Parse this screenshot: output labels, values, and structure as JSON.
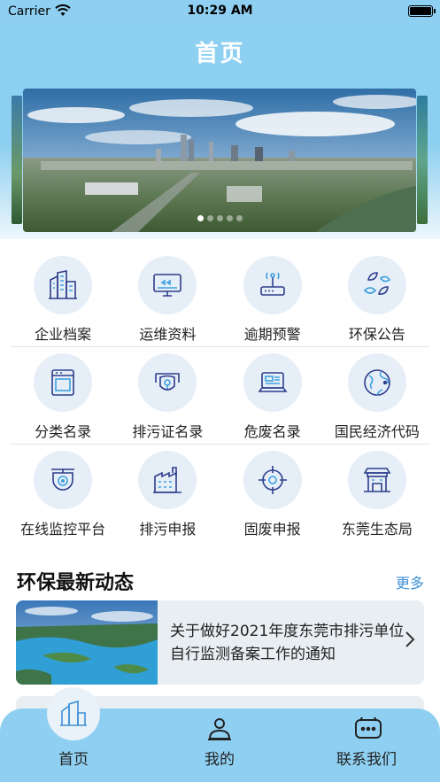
{
  "status_bar": {
    "carrier": "Carrier",
    "time": "10:29 AM"
  },
  "header": {
    "title": "首页"
  },
  "banner": {
    "slide_count": 5,
    "active_slide": 1
  },
  "grid": {
    "rows": [
      [
        {
          "label": "企业档案",
          "icon": "buildings-icon"
        },
        {
          "label": "运维资料",
          "icon": "monitor-icon"
        },
        {
          "label": "逾期预警",
          "icon": "router-alarm-icon"
        },
        {
          "label": "环保公告",
          "icon": "leaves-icon"
        }
      ],
      [
        {
          "label": "分类名录",
          "icon": "oven-icon"
        },
        {
          "label": "排污证名录",
          "icon": "certificate-icon"
        },
        {
          "label": "危废名录",
          "icon": "laptop-icon"
        },
        {
          "label": "国民经济代码",
          "icon": "globe-icon"
        }
      ],
      [
        {
          "label": "在线监控平台",
          "icon": "camera-icon"
        },
        {
          "label": "排污申报",
          "icon": "factory-icon"
        },
        {
          "label": "固废申报",
          "icon": "target-icon"
        },
        {
          "label": "东莞生态局",
          "icon": "government-building-icon"
        }
      ]
    ]
  },
  "news": {
    "heading": "环保最新动态",
    "more": "更多",
    "items": [
      {
        "title": "关于做好2021年度东莞市排污单位自行监测备案工作的通知"
      }
    ]
  },
  "tabbar": {
    "tabs": [
      {
        "label": "首页",
        "icon": "home-icon",
        "active": true
      },
      {
        "label": "我的",
        "icon": "user-icon"
      },
      {
        "label": "联系我们",
        "icon": "chat-icon"
      }
    ]
  },
  "colors": {
    "accent": "#8fd0f2",
    "icon_stroke": "#2d3e8c",
    "link": "#3d8fd6"
  }
}
